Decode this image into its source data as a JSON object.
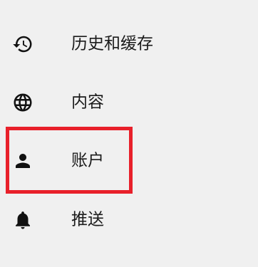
{
  "settings_menu": {
    "items": [
      {
        "label": "历史和缓存",
        "icon": "history-icon"
      },
      {
        "label": "内容",
        "icon": "globe-icon"
      },
      {
        "label": "账户",
        "icon": "person-icon"
      },
      {
        "label": "推送",
        "icon": "bell-icon"
      }
    ]
  },
  "highlight": {
    "color": "#e8202a",
    "target": "账户"
  }
}
